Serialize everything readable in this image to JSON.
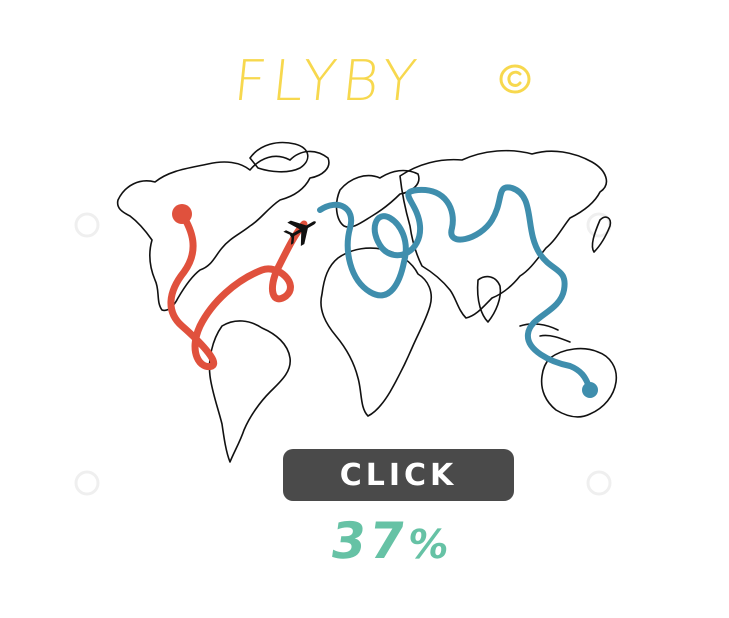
{
  "title": {
    "text": "FLYBY",
    "mark_icon": "copyright-icon",
    "color": "#f7d84e"
  },
  "map": {
    "flight_icon": "airplane-icon",
    "route_colors": {
      "west": "#e0513d",
      "east": "#3f8ead"
    },
    "outline_color": "#111111"
  },
  "action": {
    "label": "CLICK",
    "background": "#4a4a4a"
  },
  "progress": {
    "value": "37",
    "suffix": "%",
    "color": "#66c2a5"
  }
}
